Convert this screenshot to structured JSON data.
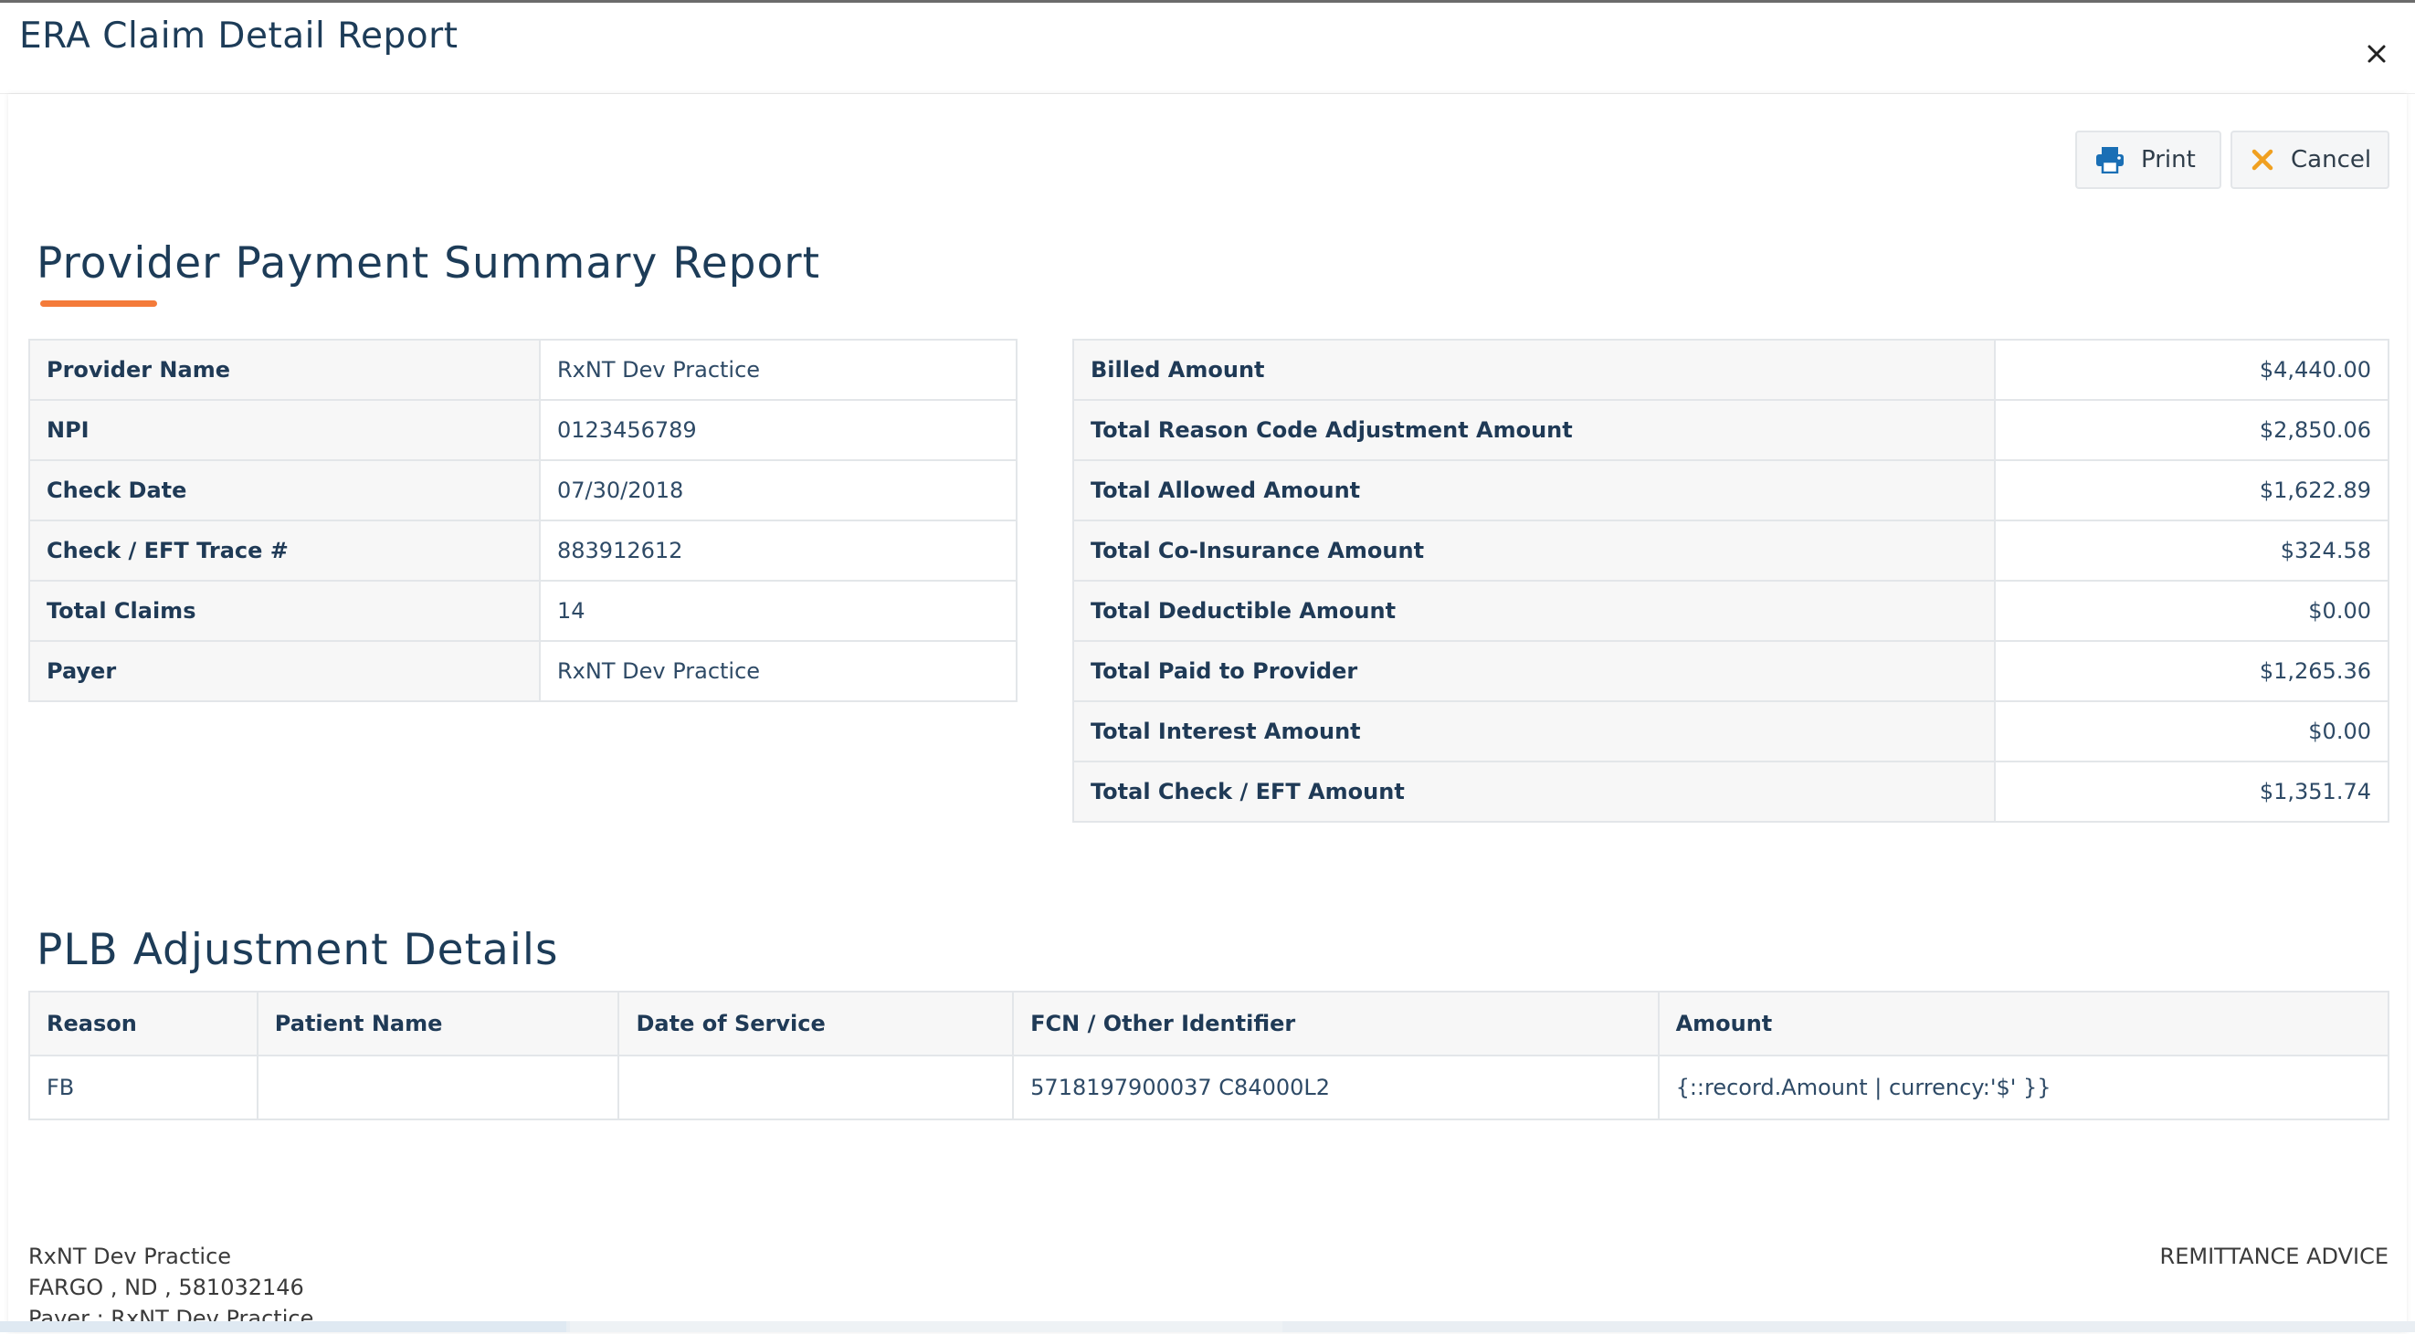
{
  "dialog": {
    "title": "ERA Claim Detail Report"
  },
  "toolbar": {
    "print_label": "Print",
    "cancel_label": "Cancel",
    "print_icon": "printer-icon",
    "cancel_icon": "x-icon",
    "print_icon_color": "#1a6fb5",
    "cancel_icon_color": "#f0a020"
  },
  "summary": {
    "title": "Provider Payment Summary Report",
    "accent_color": "#f47b3a",
    "left_rows": [
      {
        "label": "Provider Name",
        "value": "RxNT Dev Practice"
      },
      {
        "label": "NPI",
        "value": "0123456789"
      },
      {
        "label": "Check Date",
        "value": "07/30/2018"
      },
      {
        "label": "Check / EFT Trace #",
        "value": "883912612"
      },
      {
        "label": "Total Claims",
        "value": "14"
      },
      {
        "label": "Payer",
        "value": "RxNT Dev Practice"
      }
    ],
    "right_rows": [
      {
        "label": "Billed Amount",
        "value": "$4,440.00"
      },
      {
        "label": "Total Reason Code Adjustment Amount",
        "value": "$2,850.06"
      },
      {
        "label": "Total Allowed Amount",
        "value": "$1,622.89"
      },
      {
        "label": "Total Co-Insurance Amount",
        "value": "$324.58"
      },
      {
        "label": "Total Deductible Amount",
        "value": "$0.00"
      },
      {
        "label": "Total Paid to Provider",
        "value": "$1,265.36"
      },
      {
        "label": "Total Interest Amount",
        "value": "$0.00"
      },
      {
        "label": "Total Check / EFT Amount",
        "value": "$1,351.74"
      }
    ]
  },
  "plb": {
    "title": "PLB Adjustment Details",
    "columns": [
      "Reason",
      "Patient Name",
      "Date of Service",
      "FCN / Other Identifier",
      "Amount"
    ],
    "rows": [
      {
        "reason": "FB",
        "patient_name": "",
        "date_of_service": "",
        "fcn": "5718197900037 C84000L2",
        "amount": "{::record.Amount | currency:'$' }}"
      }
    ]
  },
  "footer": {
    "left_lines": [
      "RxNT Dev Practice",
      "FARGO , ND , 581032146",
      "Payer : RxNT Dev Practice"
    ],
    "right_text": "REMITTANCE ADVICE"
  }
}
